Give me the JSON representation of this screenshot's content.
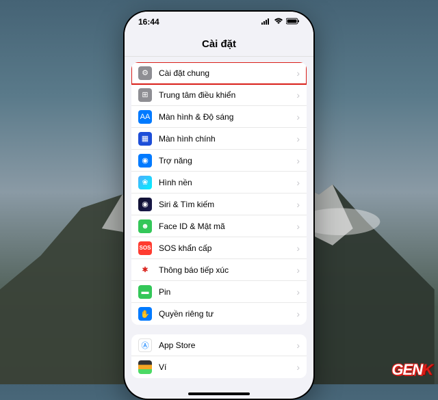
{
  "status": {
    "time": "16:44",
    "signal": "●●●●",
    "wifi": "⬢",
    "battery": "▮▮▮"
  },
  "header": {
    "title": "Cài đặt"
  },
  "groups": [
    {
      "items": [
        {
          "label": "Cài đặt chung",
          "iconClass": "i-gray",
          "glyph": "⚙",
          "highlighted": true
        },
        {
          "label": "Trung tâm điều khiển",
          "iconClass": "i-gray",
          "glyph": "⊞"
        },
        {
          "label": "Màn hình & Độ sáng",
          "iconClass": "i-blue",
          "glyph": "AA"
        },
        {
          "label": "Màn hình chính",
          "iconClass": "i-dblue",
          "glyph": "▦"
        },
        {
          "label": "Trợ năng",
          "iconClass": "i-blue",
          "glyph": "◉"
        },
        {
          "label": "Hình nền",
          "iconClass": "i-wall",
          "glyph": "❀"
        },
        {
          "label": "Siri & Tìm kiếm",
          "iconClass": "i-purple",
          "glyph": "◉"
        },
        {
          "label": "Face ID & Mật mã",
          "iconClass": "i-green",
          "glyph": "☻"
        },
        {
          "label": "SOS khẩn cấp",
          "iconClass": "i-red",
          "glyph": "SOS"
        },
        {
          "label": "Thông báo tiếp xúc",
          "iconClass": "i-rose",
          "glyph": "✱"
        },
        {
          "label": "Pin",
          "iconClass": "i-green",
          "glyph": "▬"
        },
        {
          "label": "Quyền riêng tư",
          "iconClass": "i-hand",
          "glyph": "✋"
        }
      ]
    },
    {
      "items": [
        {
          "label": "App Store",
          "iconClass": "i-appstore",
          "glyph": "Ⓐ"
        },
        {
          "label": "Ví",
          "iconClass": "i-wallet",
          "glyph": ""
        }
      ]
    }
  ],
  "watermark": {
    "text": "GEN",
    "suffix": "K"
  }
}
